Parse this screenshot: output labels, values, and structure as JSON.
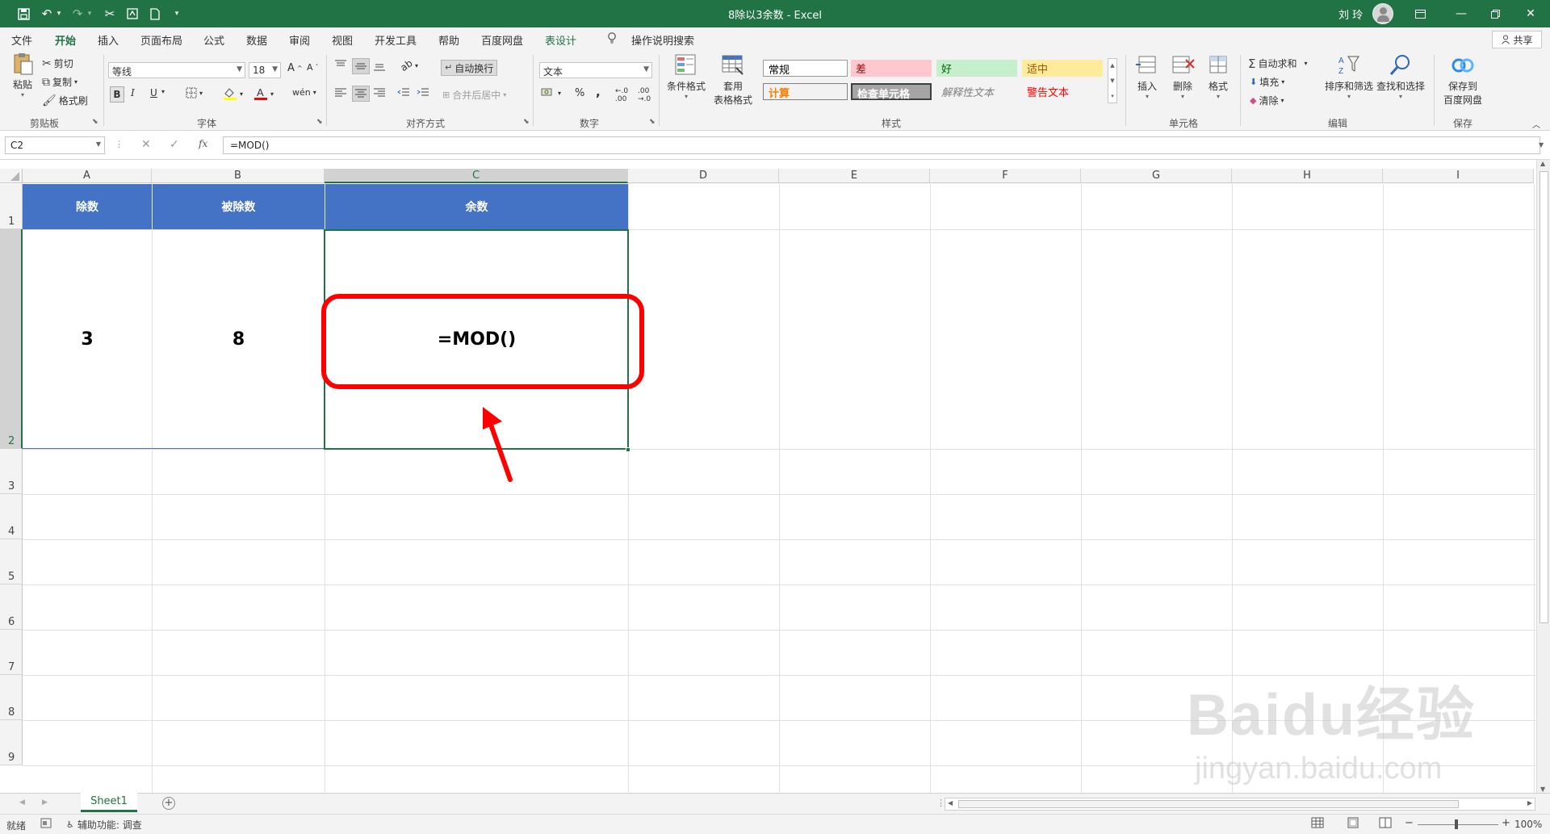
{
  "window": {
    "title": "8除以3余数 - Excel",
    "user": "刘 玲",
    "share_label": "共享"
  },
  "tabs": [
    {
      "label": "文件"
    },
    {
      "label": "开始",
      "active": true
    },
    {
      "label": "插入"
    },
    {
      "label": "页面布局"
    },
    {
      "label": "公式"
    },
    {
      "label": "数据"
    },
    {
      "label": "审阅"
    },
    {
      "label": "视图"
    },
    {
      "label": "开发工具"
    },
    {
      "label": "帮助"
    },
    {
      "label": "百度网盘"
    },
    {
      "label": "表设计"
    },
    {
      "label": "操作说明搜索"
    }
  ],
  "ribbon": {
    "clipboard": {
      "paste": "粘贴",
      "cut": "剪切",
      "copy": "复制",
      "format_painter": "格式刷",
      "label": "剪贴板"
    },
    "font": {
      "name": "等线",
      "size": "18",
      "bold": "B",
      "italic": "I",
      "underline": "U",
      "label": "字体"
    },
    "alignment": {
      "wrap": "自动换行",
      "merge": "合并后居中",
      "label": "对齐方式"
    },
    "number": {
      "format": "文本",
      "percent": "%",
      "comma": ",",
      "label": "数字"
    },
    "styles": {
      "cond_format": "条件格式",
      "table_format_1": "套用",
      "table_format_2": "表格格式",
      "normal": "常规",
      "bad": "差",
      "good": "好",
      "neutral": "适中",
      "calc": "计算",
      "check": "检查单元格",
      "explain": "解释性文本",
      "warn": "警告文本",
      "label": "样式"
    },
    "cells": {
      "insert": "插入",
      "delete": "删除",
      "format": "格式",
      "label": "单元格"
    },
    "editing": {
      "autosum": "自动求和",
      "fill": "填充",
      "clear": "清除",
      "sort": "排序和筛选",
      "find": "查找和选择",
      "label": "编辑"
    },
    "save": {
      "line1": "保存到",
      "line2": "百度网盘",
      "label": "保存"
    }
  },
  "formula_bar": {
    "name_box": "C2",
    "fx": "fx",
    "formula": "=MOD()"
  },
  "grid": {
    "columns": [
      "A",
      "B",
      "C",
      "D",
      "E",
      "F",
      "G",
      "H",
      "I"
    ],
    "rows": [
      "1",
      "2",
      "3",
      "4",
      "5",
      "6",
      "7",
      "8",
      "9"
    ],
    "headers": [
      "除数",
      "被除数",
      "余数"
    ],
    "values": [
      "3",
      "8",
      "=MOD()"
    ]
  },
  "sheets": {
    "active": "Sheet1"
  },
  "status": {
    "ready": "就绪",
    "accessibility": "辅助功能: 调查",
    "zoom": "100%"
  },
  "watermark": {
    "line1": "Baidu经验",
    "line2": "jingyan.baidu.com"
  },
  "colors": {
    "excel_green": "#217346",
    "header_blue": "#4472c4",
    "highlight_red": "#ff0000"
  }
}
